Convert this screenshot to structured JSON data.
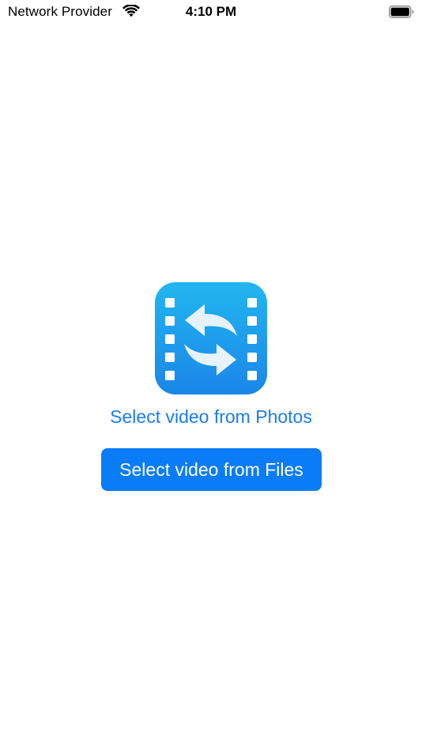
{
  "status_bar": {
    "carrier": "Network Provider",
    "time": "4:10 PM",
    "wifi_icon": "wifi-icon",
    "battery_icon": "battery-icon"
  },
  "main": {
    "app_icon": "video-convert-icon",
    "photos_link_label": "Select video from Photos",
    "files_button_label": "Select video from Files"
  },
  "colors": {
    "accent": "#0a7cf8",
    "link": "#1a7cf0",
    "icon_gradient_top": "#22b6f0",
    "icon_gradient_bottom": "#1a86e8"
  }
}
